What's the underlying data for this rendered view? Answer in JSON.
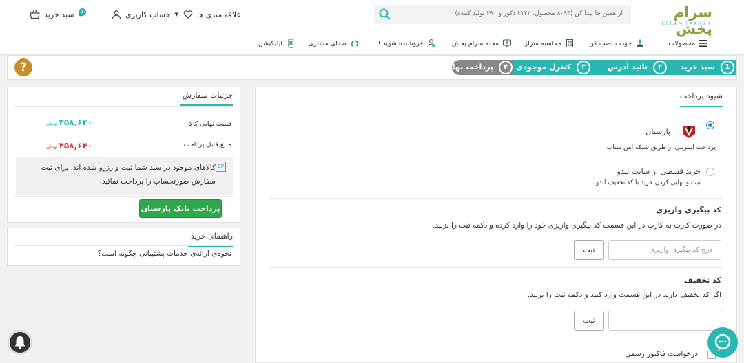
{
  "header": {
    "logo_text": "سرام پخش",
    "logo_subtext": "CERAM PAKHSH",
    "search_placeholder": "از همین جا پیدا کن (۸۰۹۴ محصول، ۳۱۴۳ دکور و ۲۹۰ تولید کننده)",
    "wishlist_label": "علاقه مندی ها",
    "account_label": "حساب کاربری",
    "cart_label": "سبد خرید",
    "cart_count": "1"
  },
  "nav": {
    "items": [
      {
        "label": "محصولات",
        "icon": "hamburger-icon"
      },
      {
        "label": "خودت نصب کن",
        "icon": "worker-icon"
      },
      {
        "label": "محاسبه متراژ",
        "icon": "calculator-icon"
      },
      {
        "label": "مجله سرام پخش",
        "icon": "magazine-icon"
      },
      {
        "label": "فروشنده شوید !",
        "icon": "seller-icon"
      },
      {
        "label": "صدای مشتری",
        "icon": "headset-icon"
      },
      {
        "label": "اپلیکیشن",
        "icon": "phone-icon"
      }
    ]
  },
  "steps": [
    {
      "num": "1",
      "label": "سبد خرید",
      "active": true
    },
    {
      "num": "۲",
      "label": "تائید آدرس",
      "active": true
    },
    {
      "num": "۳",
      "label": "کنترل موجودی",
      "active": true
    },
    {
      "num": "۴",
      "label": "پرداخت نهایی",
      "active": false
    }
  ],
  "payment": {
    "title": "شیوه پرداخت",
    "option1_label": "پارسیان",
    "option1_desc": "پرداخت اینترنتی از طریق شبکه امن شتاب",
    "option2_label": "خرید قسطی از سایت لندو",
    "option2_desc": "ثبت و نهایی کردن خرید با کد تخفیف لندو"
  },
  "tracking": {
    "title": "کد پیگیری واریزی",
    "desc": "در صورت کارت به کارت در این قسمت کد پیگیری واریزی خود را وارد کرده و دکمه ثبت را بزنید.",
    "placeholder": "درج کد پیگیری واریزی",
    "submit": "ثبت"
  },
  "discount": {
    "title": "کد تخفیف",
    "desc": "اگر کد تخفیف دارید در این قسمت وارد کنید و دکمه ثبت را بزنید.",
    "placeholder": "",
    "submit": "ثبت"
  },
  "invoice": {
    "label": "درخواست فاکتور رسمی"
  },
  "order": {
    "title": "جزئیات سفارش",
    "final_price_label": "قیمت نهایی کالا",
    "final_price_value": "۴۵۸,۶۴۰",
    "payable_label": "مبلغ قابل پرداخت",
    "payable_value": "۴۵۸,۶۴۰",
    "currency": "تومان",
    "notice": "کالاهای موجود در سبد شما ثبت و رزرو شده اند، برای ثبت سفارش صورتحساب را پرداخت نمائید.",
    "notice_icon_text": "CP",
    "pay_button": "پرداخت بانک پارسیان"
  },
  "guide": {
    "title": "راهنمای خرید",
    "item1": "نحوه‌ی ارائه‌ی خدمات پشتیبانی چگونه است؟"
  },
  "colors": {
    "accent": "#2bb7b1",
    "pay_green": "#2da94b",
    "price_teal": "#2bb7b1",
    "price_red": "#d9363e",
    "help_gold": "#c7902a"
  }
}
